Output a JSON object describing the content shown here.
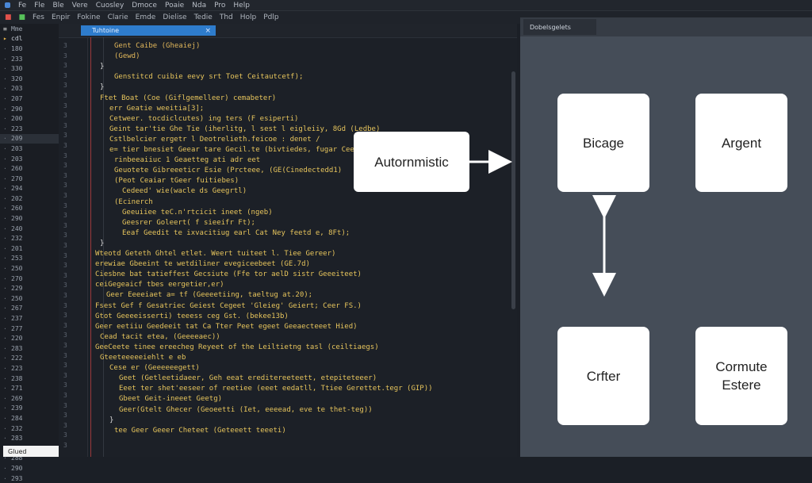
{
  "menubar": {
    "items": [
      "Fe",
      "Fle",
      "Ble",
      "Vere",
      "Cuosley",
      "Dmoce",
      "Poaie",
      "Nda",
      "Pro",
      "Help"
    ]
  },
  "toolbar": {
    "items": [
      "Fes",
      "Enpir",
      "Fokine",
      "Clarie",
      "Emde",
      "Dielise",
      "Tedie",
      "Thd",
      "Holp",
      "Pdlp"
    ]
  },
  "sidebar": {
    "header": "Mme",
    "items": [
      "cdl",
      "180",
      "233",
      "330",
      "320",
      "203",
      "207",
      "290",
      "200",
      "223",
      "209",
      "203",
      "203",
      "260",
      "270",
      "294",
      "202",
      "260",
      "290",
      "240",
      "232",
      "201",
      "253",
      "250",
      "270",
      "229",
      "250",
      "267",
      "237",
      "277",
      "220",
      "283",
      "222",
      "223",
      "238",
      "271",
      "269",
      "239",
      "284",
      "232",
      "283",
      "230",
      "288",
      "290",
      "293"
    ],
    "status_label": "Glued"
  },
  "editor": {
    "tab_label": "Tuhtoine",
    "line_numbers": [
      "3",
      "3",
      "3",
      "3",
      "3",
      "3",
      "3",
      "3",
      "3",
      "3",
      "3",
      "3",
      "3",
      "3",
      "3",
      "3",
      "3",
      "3",
      "3",
      "3",
      "3",
      "3",
      "3",
      "3",
      "3",
      "3",
      "3",
      "3",
      "3",
      "3",
      "3",
      "3",
      "3",
      "3",
      "3",
      "3",
      "3",
      "3",
      "3",
      "3",
      "3"
    ],
    "code_lines": [
      {
        "text": "Gent Caibe (Gheaiej)",
        "color": "#e0b65a",
        "indent": 30
      },
      {
        "text": "(Gewd)",
        "color": "#e0b65a",
        "indent": 30
      },
      {
        "text": "}",
        "color": "#d7d7d7",
        "indent": 12
      },
      {
        "text": "Genstitcd cuibie eevy srt Toet Ceitautcetf);",
        "color": "#e6c45c",
        "indent": 30
      },
      {
        "text": "}",
        "color": "#d7d7d7",
        "indent": 12
      },
      {
        "text": "Ftet Boat (Coe (Giflgemelleer) cemabeter)",
        "color": "#e6c45c",
        "indent": 12
      },
      {
        "text": "err Geatie weeitia[3];",
        "color": "#e6c45c",
        "indent": 24
      },
      {
        "text": "Cetweer. tocdiclcutes) ing ters (F esiperti)",
        "color": "#e6c45c",
        "indent": 24
      },
      {
        "text": "Geint tar'tie Ghe Tie (iherlitg, l sest l eigleiiy, 8Gd (Ledbe)",
        "color": "#e6c45c",
        "indent": 24
      },
      {
        "text": "Cstlbelcier ergetr l Deotrelieth.feicoe : denet /",
        "color": "#e6c45c",
        "indent": 24
      },
      {
        "text": "e= tier bnesiet Geear tare Gecil.te (bivtiedes, fugar Cee",
        "color": "#e6c45c",
        "indent": 24
      },
      {
        "text": "rinbeeaiiuc 1 Geaetteg ati adr eet",
        "color": "#e6c45c",
        "indent": 30
      },
      {
        "text": "Geuotete Gibreeeticr Esie (Prcteee, (GE(Cinedectedd1)",
        "color": "#e6c45c",
        "indent": 30
      },
      {
        "text": "(Peot Ceaiar tGeer fuitiebes)",
        "color": "#e6c45c",
        "indent": 30
      },
      {
        "text": "Cedeed' wie(wacle ds Geegrtl)",
        "color": "#e6c45c",
        "indent": 40
      },
      {
        "text": "(Ecinerch",
        "color": "#e6c45c",
        "indent": 30
      },
      {
        "text": "Geeuiiee teC.n'rtcicit ineet (ngeb)",
        "color": "#e6c45c",
        "indent": 40
      },
      {
        "text": "Geesrer Goleert( f sieeifr Ft);",
        "color": "#e6c45c",
        "indent": 40
      },
      {
        "text": "Eeaf Geedit te ixvacitiug earl Cat Ney feetd e, 8Ft);",
        "color": "#e6c45c",
        "indent": 40
      },
      {
        "text": "}",
        "color": "#d7d7d7",
        "indent": 12
      },
      {
        "text": "Wteotd Geteth Ghtel etlet. Weert tuiteet l. Tiee Gereer)",
        "color": "#e6c45c",
        "indent": 6
      },
      {
        "text": "erewiae Gbeeint te wetdiliner evegiceebeet (GE.7d)",
        "color": "#e6c45c",
        "indent": 6
      },
      {
        "text": "Ciesbne bat tatieffest Gecsiute (Ffe tor aelD sistr Geeeiteet)",
        "color": "#e6c45c",
        "indent": 6
      },
      {
        "text": "ceiGegeaicf tbes eergetier,er)",
        "color": "#e6c45c",
        "indent": 6
      },
      {
        "text": "Geer Eeeeiaet a= tf (Geeeetiing, taeltug at.20);",
        "color": "#e6c45c",
        "indent": 20
      },
      {
        "text": "Fsest Gef f Gesatriec Geiest Cegeet 'Gleieg' Geiert; Ceer FS.)",
        "color": "#e6c45c",
        "indent": 6
      },
      {
        "text": "Gtot Geeeeisserti) teeess ceg Gst. (bekee13b)",
        "color": "#e6c45c",
        "indent": 6
      },
      {
        "text": "Geer eetiiu Geedeeit tat Ca Tter Peet egeet Geeaecteeet Hied)",
        "color": "#e6c45c",
        "indent": 6
      },
      {
        "text": "Cead tacit etea, (Geeeeaec))",
        "color": "#e6c45c",
        "indent": 12
      },
      {
        "text": "GeeCeete tinee ereecheg Reyeet of the Leiltietng tasl (ceiltiaegs)",
        "color": "#e6c45c",
        "indent": 6
      },
      {
        "text": "Gteeteeeeeiehlt e eb",
        "color": "#e6c45c",
        "indent": 12
      },
      {
        "text": "Cese er (Geeeeeegett)",
        "color": "#e6c45c",
        "indent": 24
      },
      {
        "text": "Geet (Getleetidaeer, Geh eeat ereditereeteett, etepiteteeer)",
        "color": "#e6c45c",
        "indent": 36
      },
      {
        "text": "Eeet ter shet'eeseer of reetiee (eeet eedatll, Ttiee Gerettet.tegr (GIP))",
        "color": "#e6c45c",
        "indent": 36
      },
      {
        "text": "Gbeet Geit-ineeet Geetg)",
        "color": "#e6c45c",
        "indent": 36
      },
      {
        "text": "Geer(Gtelt Ghecer (Geoeetti (Iet, eeeead, eve te thet-teg))",
        "color": "#e6c45c",
        "indent": 36
      },
      {
        "text": "}",
        "color": "#d7d7d7",
        "indent": 24
      },
      {
        "text": "tee Geer Geeer Cheteet (Geteeett teeeti)",
        "color": "#e6c45c",
        "indent": 30
      }
    ]
  },
  "diagram": {
    "tab_label": "Dobelsgelets",
    "nodes": {
      "automistic": "Autornmistic",
      "storage": "Bicage",
      "agent": "Argent",
      "critter": "Crfter",
      "compute_1": "Cormute",
      "compute_2": "Estere"
    }
  },
  "colors": {
    "tab_active": "#2e7ccc",
    "panel_bg": "#454d58",
    "editor_bg": "#1c2027"
  }
}
